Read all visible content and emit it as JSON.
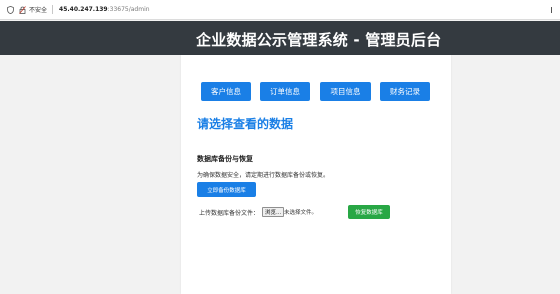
{
  "browser": {
    "insecure_label": "不安全",
    "url_host": "45.40.247.139",
    "url_path": ":33675/admin"
  },
  "header": {
    "title": "企业数据公示管理系统 - 管理员后台"
  },
  "nav": {
    "customer_info": "客户信息",
    "order_info": "订单信息",
    "project_info": "项目信息",
    "finance_records": "财务记录"
  },
  "main": {
    "section_heading": "请选择查看的数据"
  },
  "backup": {
    "title": "数据库备份与恢复",
    "description": "为确保数据安全，请定期进行数据库备份或恢复。",
    "backup_button": "立即备份数据库",
    "upload_label": "上传数据库备份文件：",
    "choose_file_button": "浏览...",
    "no_file_text": "未选择文件。",
    "restore_button": "恢复数据库"
  },
  "colors": {
    "header_bg": "#343a40",
    "primary": "#1a7fe6",
    "success": "#28a745",
    "page_bg": "#f2f2f2"
  },
  "icons": [
    "shield-icon",
    "lock-icon"
  ]
}
